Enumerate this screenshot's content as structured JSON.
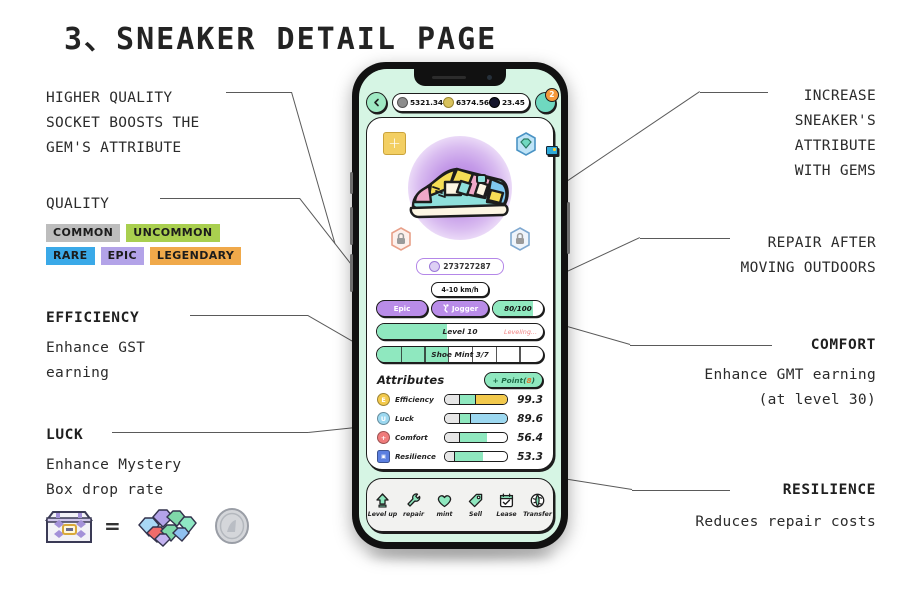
{
  "page": {
    "title": "3、SNEAKER DETAIL PAGE"
  },
  "annotations": {
    "socket": {
      "line1": "HIGHER QUALITY",
      "line2": "SOCKET BOOSTS THE",
      "line3": "GEM'S ATTRIBUTE"
    },
    "quality": {
      "heading": "QUALITY"
    },
    "efficiency": {
      "heading": "EFFICIENCY",
      "line1": "Enhance GST",
      "line2": "earning"
    },
    "luck": {
      "heading": "LUCK",
      "line1": "Enhance Mystery",
      "line2": "Box drop rate"
    },
    "gems": {
      "line1": "INCREASE",
      "line2": "SNEAKER'S",
      "line3": "ATTRIBUTE",
      "line4": "WITH GEMS"
    },
    "repair": {
      "line1": "REPAIR AFTER",
      "line2": "MOVING OUTDOORS"
    },
    "comfort": {
      "heading": "COMFORT",
      "line1": "Enhance GMT earning",
      "line2": "(at level 30)"
    },
    "resilience": {
      "heading": "RESILIENCE",
      "line1": "Reduces repair costs"
    },
    "equals": "="
  },
  "quality_levels": [
    {
      "label": "COMMON",
      "color": "#bdbdbd"
    },
    {
      "label": "UNCOMMON",
      "color": "#a9cf4f"
    },
    {
      "label": "RARE",
      "color": "#3aa9e8"
    },
    {
      "label": "EPIC",
      "color": "#b3a3e8"
    },
    {
      "label": "LEGENDARY",
      "color": "#f0a94a"
    }
  ],
  "phone": {
    "topbar": {
      "back_icon": "chevron-left-icon",
      "currencies": [
        {
          "icon": "gst-coin-icon",
          "color": "#8d8d8d",
          "value": "5321.34"
        },
        {
          "icon": "gmt-coin-icon",
          "color": "#d8c25c",
          "value": "6374.56"
        },
        {
          "icon": "token-coin-icon",
          "color": "#14142b",
          "value": "23.45"
        }
      ],
      "wallet_icon": "wallet-icon",
      "wallet_badge": "2"
    },
    "hero": {
      "shoe_icon": "sneaker-icon",
      "sockets": [
        {
          "name": "socket-add",
          "type": "add",
          "state": "empty"
        },
        {
          "name": "socket-gem",
          "type": "gem",
          "state": "filled"
        },
        {
          "name": "socket-lock-left",
          "type": "lock",
          "state": "locked"
        },
        {
          "name": "socket-lock-right",
          "type": "lock",
          "state": "locked"
        }
      ]
    },
    "shoe_id": "273727287",
    "quality_badge": "Epic",
    "speed_tag": "4-10 km/h",
    "shoe_type": "Jogger",
    "durability": {
      "value": "80/100",
      "percent": 80
    },
    "level_bar": {
      "label": "Level 10",
      "status": "Leveling...",
      "percent": 42
    },
    "mint_bar": {
      "label": "Shoe Mint 3/7",
      "percent": 43,
      "total": 7,
      "used": 3
    },
    "attributes_header": "Attributes",
    "point_button": {
      "prefix": "+ Point(",
      "count": "8",
      "suffix": ")"
    },
    "attributes": [
      {
        "icon": "efficiency-icon",
        "glyph": "E",
        "color": "#f2c94c",
        "shape": "circle",
        "name": "Efficiency",
        "value": "99.3",
        "base_pct": 22,
        "mid_pct": 27,
        "top_pct": 46,
        "top_color": "#f2c94c"
      },
      {
        "icon": "luck-icon",
        "glyph": "U",
        "color": "#9cd8f0",
        "shape": "circle",
        "name": "Luck",
        "value": "89.6",
        "base_pct": 22,
        "mid_pct": 18,
        "top_pct": 60,
        "top_color": "#9cd8f0"
      },
      {
        "icon": "comfort-icon",
        "glyph": "+",
        "color": "#ef7b7b",
        "shape": "circle",
        "name": "Comfort",
        "value": "56.4",
        "base_pct": 22,
        "mid_pct": 45,
        "top_pct": 0,
        "top_color": "#8fe8bf"
      },
      {
        "icon": "resilience-icon",
        "glyph": "◻",
        "color": "#5b7fe0",
        "shape": "square",
        "name": "Resilience",
        "value": "53.3",
        "base_pct": 14,
        "mid_pct": 48,
        "top_pct": 0,
        "top_color": "#8fe8bf"
      }
    ],
    "nav": [
      {
        "icon": "arrow-up-icon",
        "label": "Level up"
      },
      {
        "icon": "wrench-icon",
        "label": "repair"
      },
      {
        "icon": "heart-icon",
        "label": "mint"
      },
      {
        "icon": "tag-icon",
        "label": "Sell"
      },
      {
        "icon": "calendar-icon",
        "label": "Lease"
      },
      {
        "icon": "globe-icon",
        "label": "Transfer"
      }
    ]
  },
  "colors": {
    "screen_bg": "#d6f5e4",
    "accent_mint": "#8fe8bf",
    "epic_purple": "#b98ce8",
    "outline": "#1d1d1d"
  }
}
